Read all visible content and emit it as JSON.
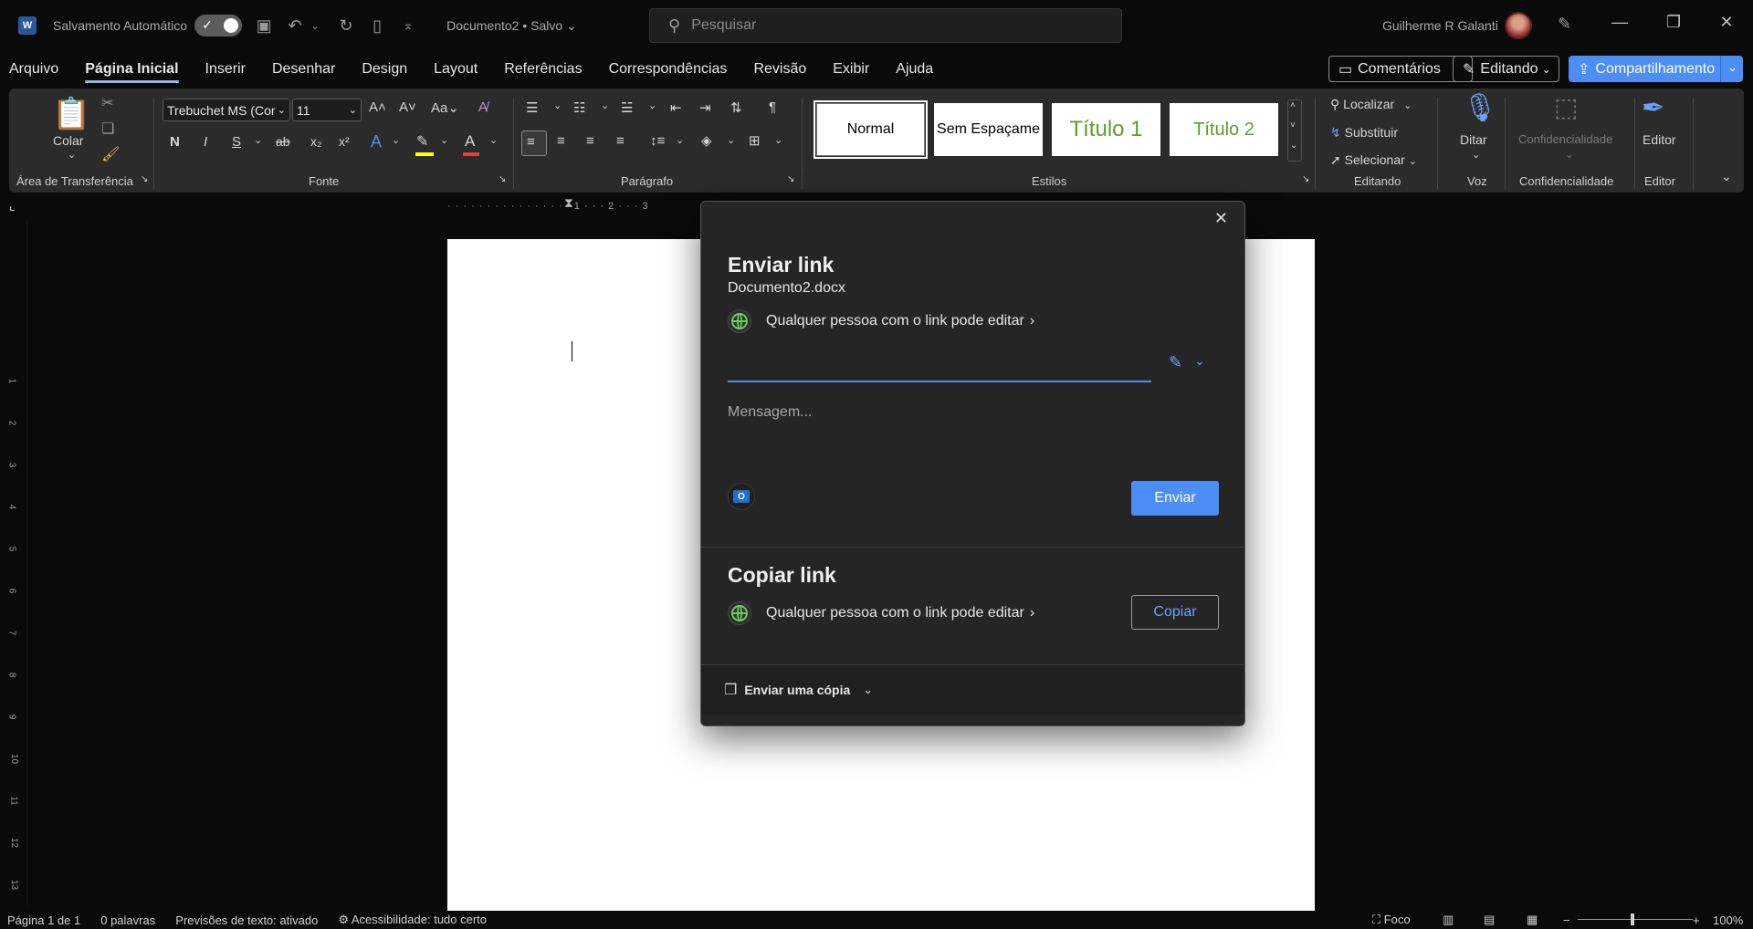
{
  "titlebar": {
    "autosave_label": "Salvamento Automático",
    "document_title": "Documento2 • Salvo ⌄",
    "search_placeholder": "Pesquisar",
    "user_name": "Guilherme R Galanti"
  },
  "menubar": {
    "items": [
      "Arquivo",
      "Página Inicial",
      "Inserir",
      "Desenhar",
      "Design",
      "Layout",
      "Referências",
      "Correspondências",
      "Revisão",
      "Exibir",
      "Ajuda"
    ],
    "comments": "Comentários",
    "editing": "Editando",
    "share": "Compartilhamento"
  },
  "ribbon": {
    "clipboard": {
      "paste": "Colar",
      "label": "Área de Transferência"
    },
    "font": {
      "name": "Trebuchet MS (Cor",
      "size": "11",
      "label": "Fonte",
      "bold": "N",
      "italic": "I",
      "underline": "S"
    },
    "paragraph": {
      "label": "Parágrafo"
    },
    "styles": {
      "items": [
        "Normal",
        "Sem Espaçame",
        "Título 1",
        "Título 2"
      ],
      "label": "Estilos",
      "accent_color": "#5e9c2d"
    },
    "editing": {
      "find": "Localizar",
      "replace": "Substituir",
      "select": "Selecionar",
      "label": "Editando"
    },
    "voice": {
      "dictate": "Ditar",
      "label": "Voz"
    },
    "sensitivity": {
      "button": "Confidencialidade",
      "label": "Confidencialidade"
    },
    "editor": {
      "button": "Editor",
      "label": "Editor"
    }
  },
  "ruler": {
    "marks": [
      "1",
      "2",
      "3"
    ]
  },
  "vruler": {
    "marks": [
      "1",
      "2",
      "3",
      "4",
      "5",
      "6",
      "7",
      "8",
      "9",
      "10",
      "11",
      "12",
      "13"
    ]
  },
  "dialog": {
    "send_title": "Enviar link",
    "filename": "Documento2.docx",
    "permission": "Qualquer pessoa com o link pode editar",
    "message_placeholder": "Mensagem...",
    "send_button": "Enviar",
    "copy_title": "Copiar link",
    "copy_permission": "Qualquer pessoa com o link pode editar",
    "copy_button": "Copiar",
    "send_copy": "Enviar uma cópia"
  },
  "statusbar": {
    "page": "Página 1 de 1",
    "words": "0 palavras",
    "predictions": "Previsões de texto: ativado",
    "accessibility": "Acessibilidade: tudo certo",
    "focus": "Foco",
    "zoom": "100%"
  },
  "colors": {
    "accent_blue": "#4c8df6",
    "globe_green": "#6ccb5f"
  }
}
